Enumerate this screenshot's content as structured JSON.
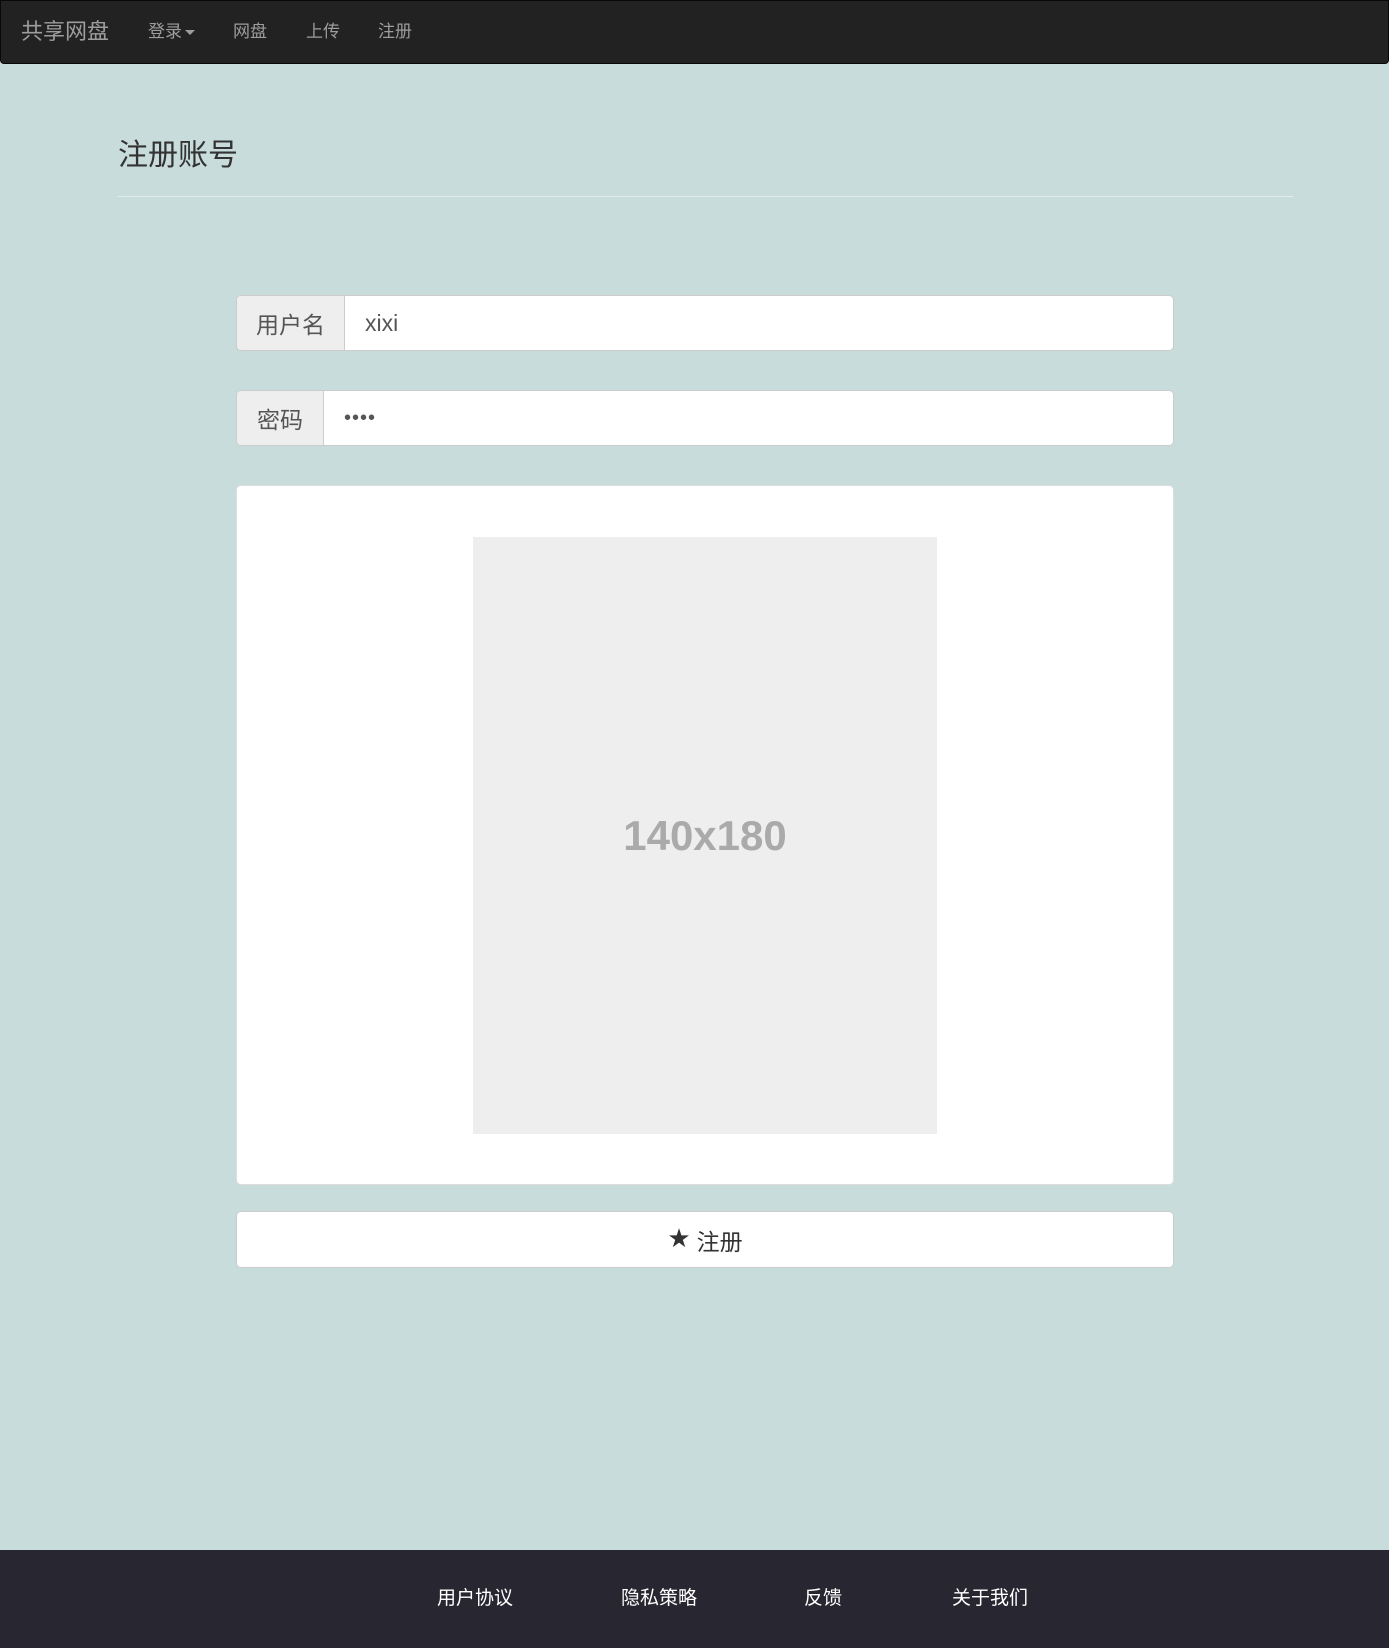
{
  "navbar": {
    "brand": "共享网盘",
    "items": [
      {
        "label": "登录",
        "dropdown": true
      },
      {
        "label": "网盘"
      },
      {
        "label": "上传"
      },
      {
        "label": "注册"
      }
    ]
  },
  "page": {
    "title": "注册账号"
  },
  "form": {
    "username": {
      "label": "用户名",
      "value": "xixi"
    },
    "password": {
      "label": "密码",
      "value": "••••"
    },
    "image_placeholder": "140x180",
    "submit_label": "注册",
    "submit_icon": "star-icon"
  },
  "footer": {
    "links": [
      "用户协议",
      "隐私策略",
      "反馈",
      "关于我们"
    ]
  },
  "colors": {
    "page_background": "#c8dddb",
    "navbar_background": "#222222",
    "footer_background": "#282630"
  }
}
